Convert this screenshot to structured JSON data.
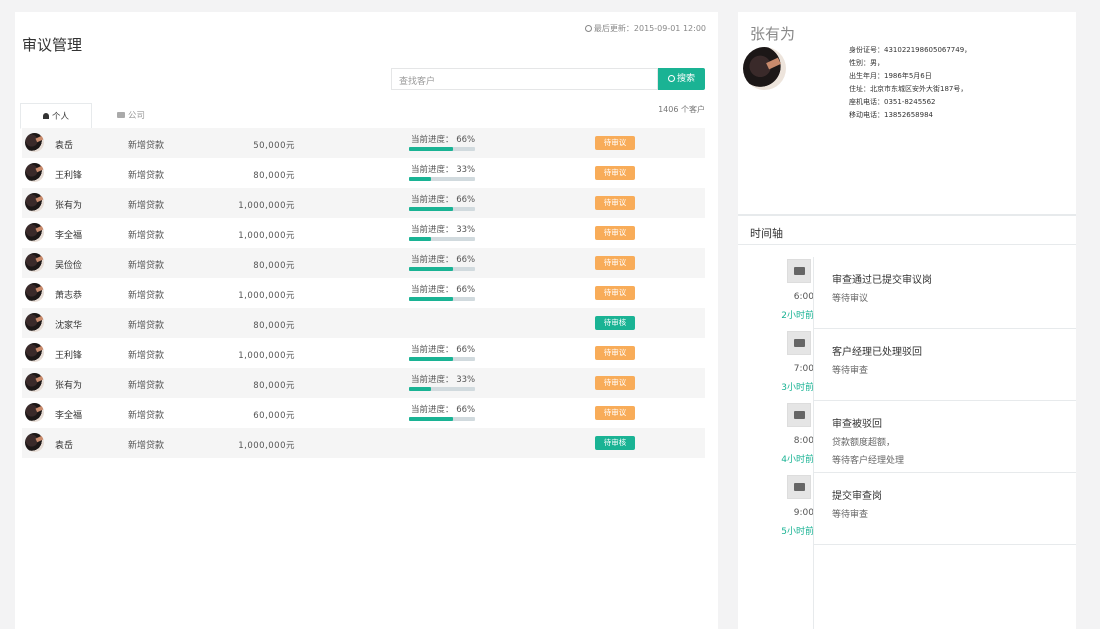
{
  "header": {
    "last_update": "最后更新：2015-09-01 12:00",
    "title": "审议管理"
  },
  "search": {
    "placeholder": "查找客户",
    "button": "搜索"
  },
  "customer_count": "1406 个客户",
  "tabs": [
    {
      "label": "个人",
      "active": true
    },
    {
      "label": "公司",
      "active": false
    }
  ],
  "rows": [
    {
      "name": "袁岳",
      "type": "新增贷款",
      "amount": "50,000元",
      "progress_label": "当前进度： 66%",
      "progress": 66,
      "status": "待审议"
    },
    {
      "name": "王利锋",
      "type": "新增贷款",
      "amount": "80,000元",
      "progress_label": "当前进度： 33%",
      "progress": 33,
      "status": "待审议"
    },
    {
      "name": "张有为",
      "type": "新增贷款",
      "amount": "1,000,000元",
      "progress_label": "当前进度： 66%",
      "progress": 66,
      "status": "待审议"
    },
    {
      "name": "李全福",
      "type": "新增贷款",
      "amount": "1,000,000元",
      "progress_label": "当前进度： 33%",
      "progress": 33,
      "status": "待审议"
    },
    {
      "name": "吴俭俭",
      "type": "新增贷款",
      "amount": "80,000元",
      "progress_label": "当前进度： 66%",
      "progress": 66,
      "status": "待审议"
    },
    {
      "name": "萧志恭",
      "type": "新增贷款",
      "amount": "1,000,000元",
      "progress_label": "当前进度： 66%",
      "progress": 66,
      "status": "待审议"
    },
    {
      "name": "沈家华",
      "type": "新增贷款",
      "amount": "80,000元",
      "progress_label": "",
      "progress": null,
      "status": "待审核"
    },
    {
      "name": "王利锋",
      "type": "新增贷款",
      "amount": "1,000,000元",
      "progress_label": "当前进度： 66%",
      "progress": 66,
      "status": "待审议"
    },
    {
      "name": "张有为",
      "type": "新增贷款",
      "amount": "80,000元",
      "progress_label": "当前进度： 33%",
      "progress": 33,
      "status": "待审议"
    },
    {
      "name": "李全福",
      "type": "新增贷款",
      "amount": "60,000元",
      "progress_label": "当前进度： 66%",
      "progress": 66,
      "status": "待审议"
    },
    {
      "name": "袁岳",
      "type": "新增贷款",
      "amount": "1,000,000元",
      "progress_label": "",
      "progress": null,
      "status": "待审核"
    }
  ],
  "status_colors": {
    "待审议": "#f8ac59",
    "待审核": "#1ab394"
  },
  "profile": {
    "name": "张有为",
    "id_number": "身份证号：431022198605067749，",
    "gender": "性别：男，",
    "birth": "出生年月：1986年5月6日",
    "address": "住址：北京市东城区安外大街187号，",
    "phone": "座机电话：0351-8245562",
    "mobile": "移动电话：13852658984"
  },
  "timeline": {
    "title": "时间轴",
    "items": [
      {
        "icon": "briefcase-icon",
        "time": "6:00",
        "ago": "2小时前",
        "heading": "审查通过已提交审议岗",
        "lines": [
          "等待审议"
        ]
      },
      {
        "icon": "document-icon",
        "time": "7:00",
        "ago": "3小时前",
        "heading": "客户经理已处理驳回",
        "lines": [
          "等待审查"
        ]
      },
      {
        "icon": "coffee-icon",
        "time": "8:00",
        "ago": "4小时前",
        "heading": "审查被驳回",
        "lines": [
          "贷款额度超额，",
          "等待客户经理处理"
        ]
      },
      {
        "icon": "coffee-icon",
        "time": "9:00",
        "ago": "5小时前",
        "heading": "提交审查岗",
        "lines": [
          "等待审查"
        ]
      }
    ]
  }
}
